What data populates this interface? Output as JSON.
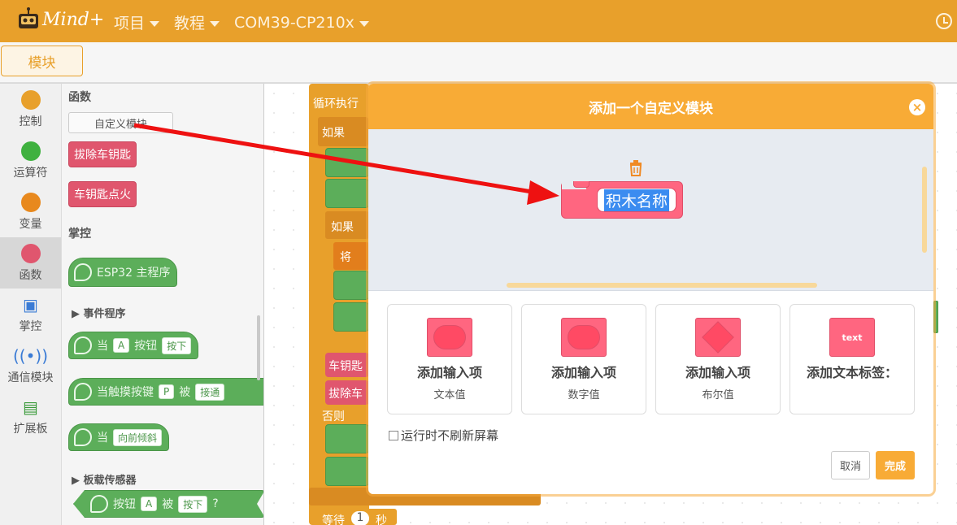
{
  "app": {
    "logo_text": "Mind+",
    "menu": [
      "项目",
      "教程",
      "COM39-CP210x"
    ],
    "tab": "模块"
  },
  "categories": [
    {
      "label": "控制",
      "color": "#e8a02b"
    },
    {
      "label": "运算符",
      "color": "#3fb13f"
    },
    {
      "label": "变量",
      "color": "#e8891e"
    },
    {
      "label": "函数",
      "color": "#e0566e"
    },
    {
      "label": "掌控",
      "color": "#3a7bd5"
    },
    {
      "label": "通信模块",
      "color": "#3a7bd5"
    },
    {
      "label": "扩展板",
      "color": "#3a9a3a"
    }
  ],
  "palette": {
    "section_functions": "函数",
    "custom_block_button": "自定义模块",
    "func_blocks": [
      "拔除车钥匙",
      "车钥匙点火"
    ],
    "section_control": "掌控",
    "main_program": "ESP32 主程序",
    "event_section": "▶ 事件程序",
    "when": "当",
    "btn_a": "A",
    "button": "按钮",
    "pressed": "按下",
    "touch": "当触摸按键",
    "touch_p": "P",
    "by": "被",
    "touched": "接通",
    "tilt": "向前倾斜",
    "onboard_section": "▶ 板载传感器",
    "btn_label": "按钮",
    "btn_a2": "A",
    "by2": "被",
    "pressed2": "按下",
    "q": "?"
  },
  "workspace": {
    "loop_label": "循环执行",
    "if1": "如果",
    "if2": "如果",
    "set": "将",
    "key1": "车钥匙",
    "key2": "拔除车",
    "else": "否则",
    "wait": "等待",
    "wait_value": "1",
    "wait_unit": "秒"
  },
  "modal": {
    "title": "添加一个自定义模块",
    "close": "×",
    "block_name": "积木名称",
    "options": [
      {
        "title": "添加输入项",
        "sub": "文本值",
        "icon": "string-input-icon"
      },
      {
        "title": "添加输入项",
        "sub": "数字值",
        "icon": "number-input-icon"
      },
      {
        "title": "添加输入项",
        "sub": "布尔值",
        "icon": "boolean-input-icon"
      },
      {
        "title": "添加文本标签：",
        "sub": "",
        "icon": "text-label-icon",
        "icon_text": "text"
      }
    ],
    "checkbox_label": "运行时不刷新屏幕",
    "cancel": "取消",
    "done": "完成"
  },
  "colors": {
    "topbar": "#e8a02b",
    "modal_header": "#f8ab36",
    "function_block": "#ff6680",
    "annotation_arrow": "#ee1111"
  }
}
